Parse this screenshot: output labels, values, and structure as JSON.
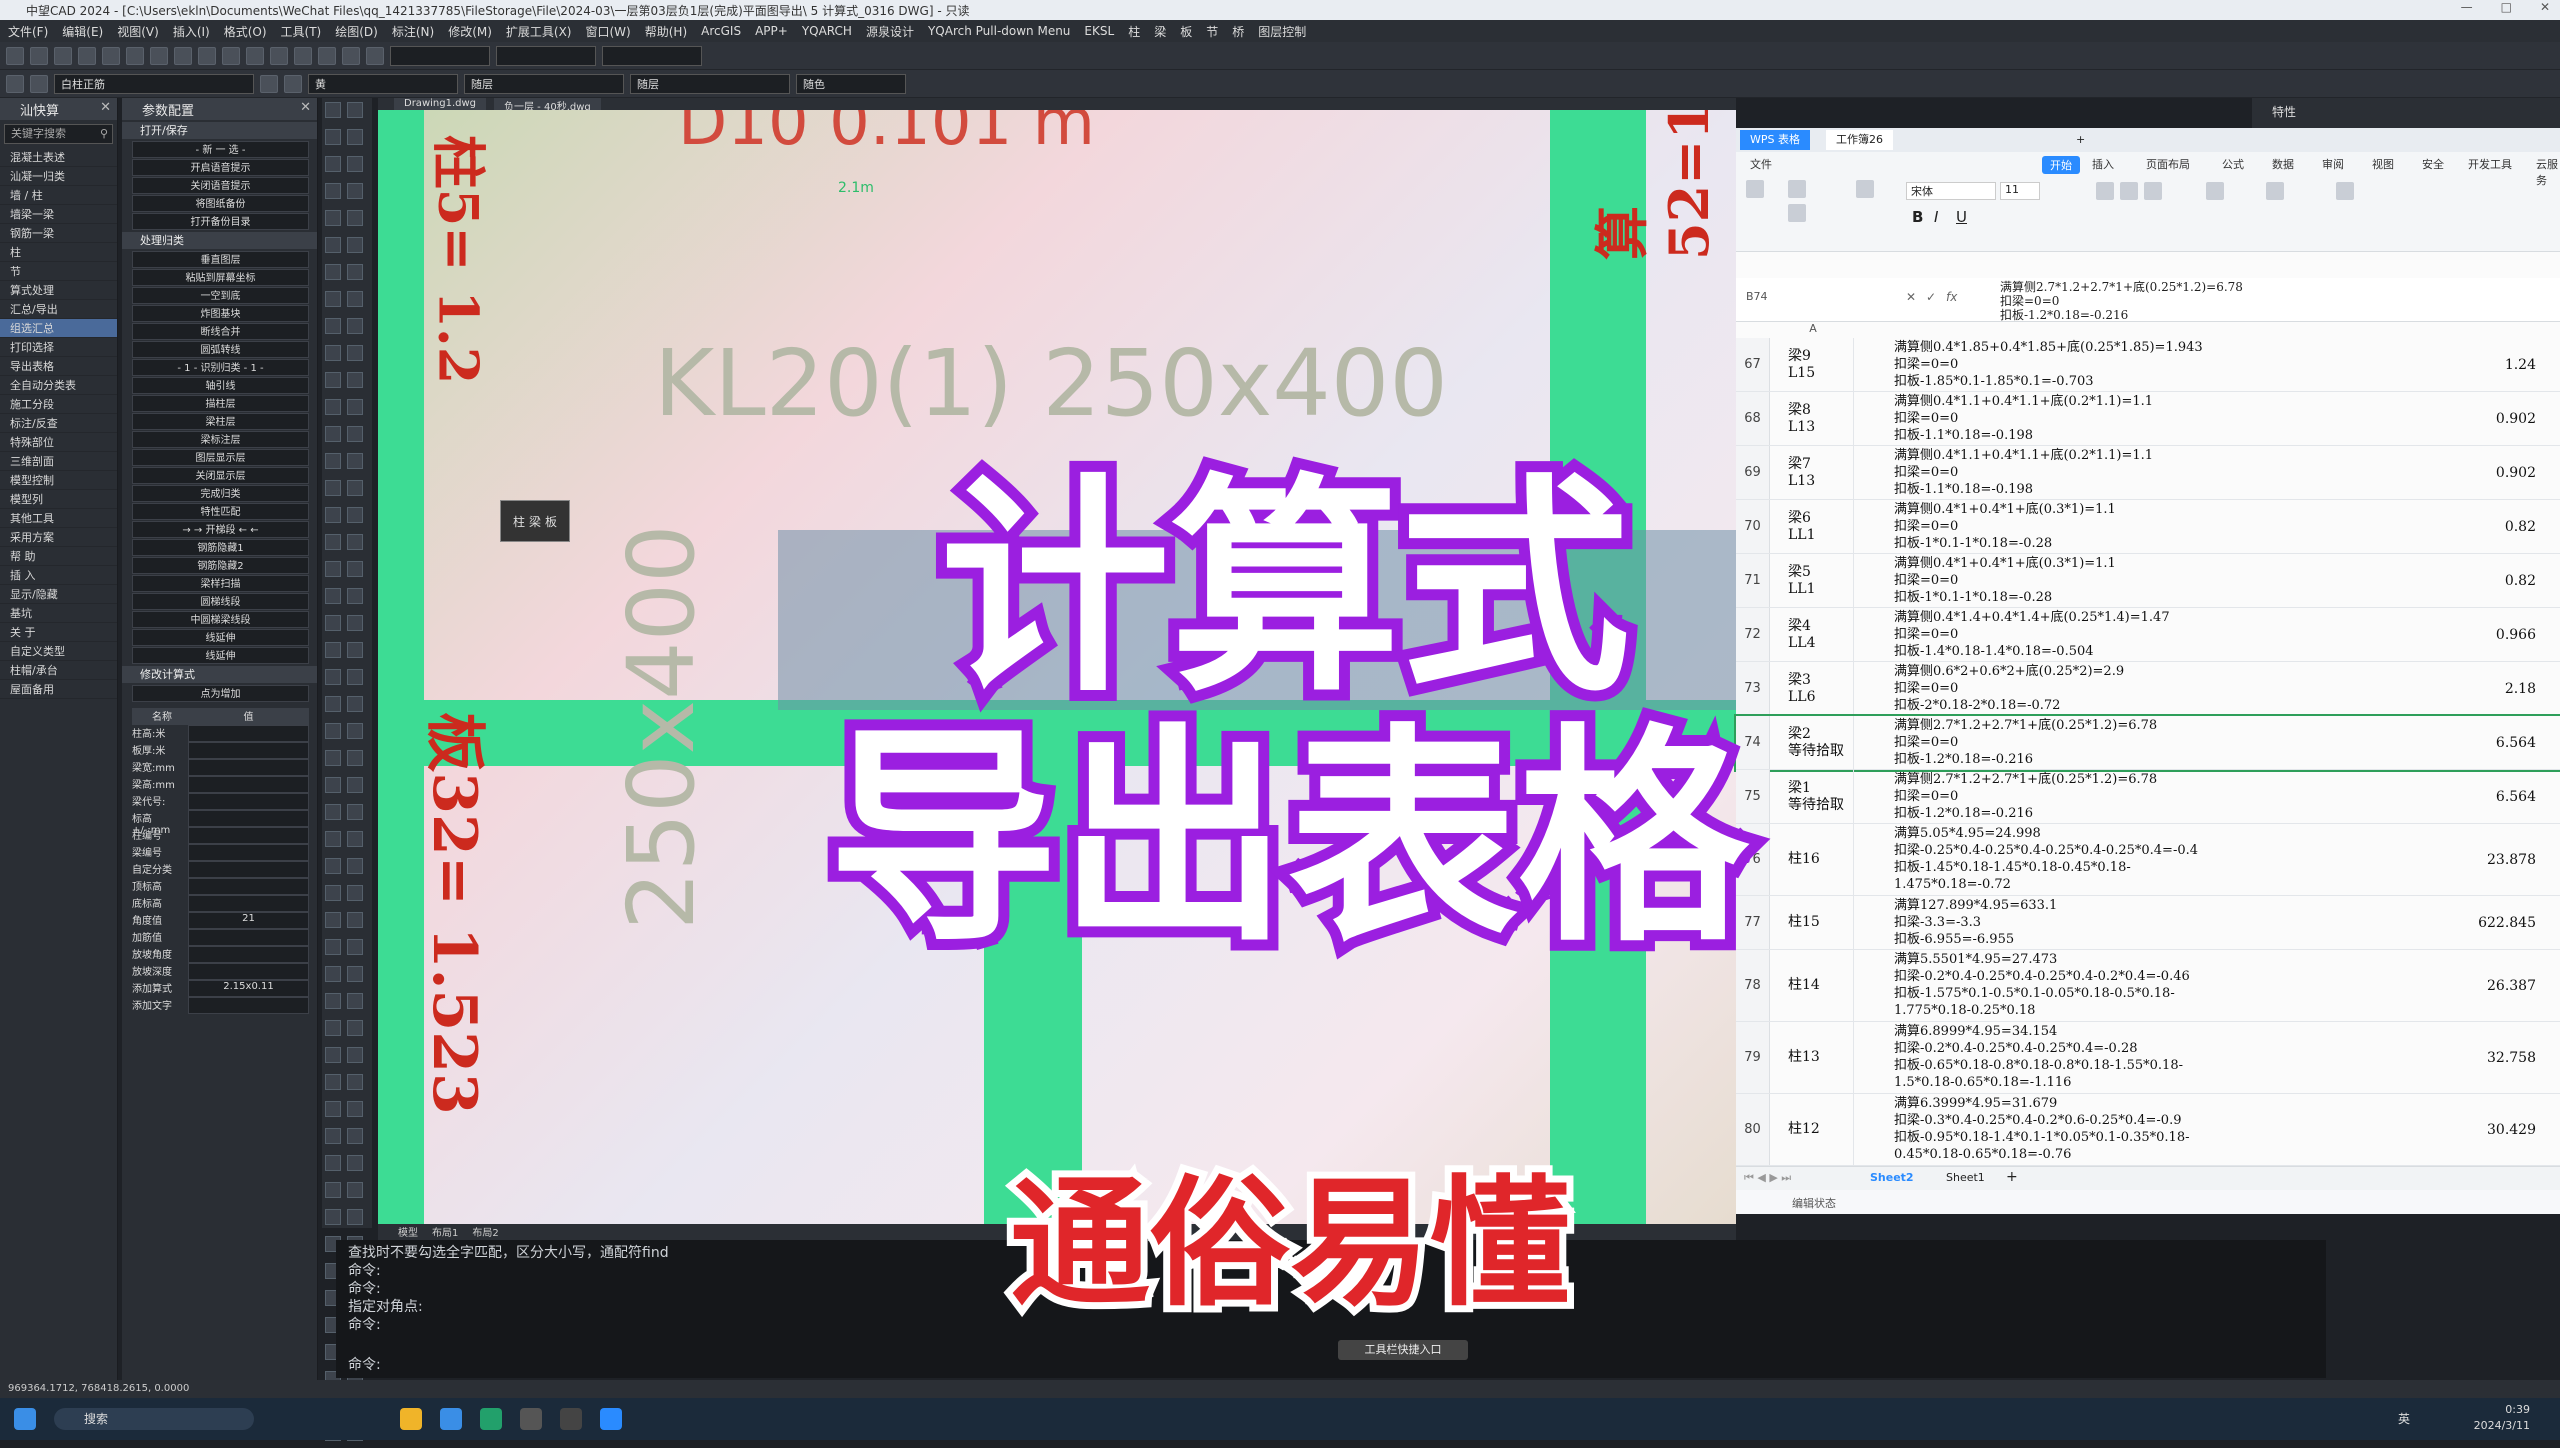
{
  "window": {
    "title": "中望CAD 2024 - [C:\\Users\\ekln\\Documents\\WeChat Files\\qq_1421337785\\FileStorage\\File\\2024-03\\一层第03层负1层(完成)平面图导出\\ 5 计算式_0316 DWG] - 只读"
  },
  "menu": [
    "文件(F)",
    "编辑(E)",
    "视图(V)",
    "插入(I)",
    "格式(O)",
    "工具(T)",
    "绘图(D)",
    "标注(N)",
    "修改(M)",
    "扩展工具(X)",
    "窗口(W)",
    "帮助(H)",
    "ArcGIS",
    "APP+",
    "YQARCH",
    "源泉设计",
    "YQArch Pull-down Menu",
    "EKSL",
    "柱",
    "梁",
    "板",
    "节",
    "桥",
    "图层控制"
  ],
  "toolbar": {
    "layer_combo": "白柱正筋",
    "color_combo": "黄",
    "linetype_combo": "随层",
    "lineweight_combo": "随层",
    "plot_combo": "随色"
  },
  "panelA": {
    "title": "汕快算",
    "search_placeholder": "关键字搜索",
    "items": [
      "混凝土表述",
      "汕凝一归类",
      "墙 / 柱",
      "墙梁一梁",
      "钢筋一梁",
      "柱",
      "节",
      "算式处理",
      "汇总/导出",
      "组选汇总",
      "打印选择",
      "导出表格",
      "全自动分类表",
      "施工分段",
      "标注/反查",
      "特殊部位",
      "三维剖面",
      "模型控制",
      "模型列",
      "其他工具",
      "采用方案",
      "帮 助",
      "插 入",
      "显示/隐藏",
      "基坑",
      "关 于",
      "自定义类型",
      "柱帽/承台",
      "屋面备用"
    ]
  },
  "panelB": {
    "title": "参数配置",
    "group1": "打开/保存",
    "group1_items": [
      "- 新 一 选 -",
      "开启语音提示",
      "关闭语音提示",
      "将图纸备份",
      "打开备份目录"
    ],
    "group2": "处理归类",
    "group2_items": [
      "垂直图层",
      "粘贴到屏幕坐标",
      "一空到底",
      "炸图基块",
      "断线合并",
      "圆弧转线",
      "- 1 - 识别归类 - 1 -",
      "轴引线",
      "描柱层",
      "梁柱层",
      "梁标注层",
      "图层显示层",
      "关闭显示层",
      "完成归类",
      "特性匹配",
      "→ → 开梯段 ← ←",
      "钢筋隐藏1",
      "钢筋隐藏2",
      "梁样扫描",
      "圆梯线段",
      "中圆梯梁线段",
      "线延伸",
      "线延伸"
    ],
    "group3": "修改计算式",
    "add_label": "点为增加",
    "prop_header": [
      "名称",
      "值"
    ],
    "props": [
      {
        "k": "柱高:米",
        "v": ""
      },
      {
        "k": "板厚:米",
        "v": ""
      },
      {
        "k": "梁宽:mm",
        "v": ""
      },
      {
        "k": "梁高:mm",
        "v": ""
      },
      {
        "k": "梁代号:",
        "v": ""
      },
      {
        "k": "标高+/-:mm",
        "v": ""
      },
      {
        "k": "柱编号",
        "v": ""
      },
      {
        "k": "梁编号",
        "v": ""
      },
      {
        "k": "自定分类",
        "v": ""
      },
      {
        "k": "顶标高",
        "v": ""
      },
      {
        "k": "底标高",
        "v": ""
      },
      {
        "k": "角度值",
        "v": "21"
      },
      {
        "k": "加筋值",
        "v": ""
      },
      {
        "k": "放坡角度",
        "v": ""
      },
      {
        "k": "放坡深度",
        "v": ""
      },
      {
        "k": "添加算式",
        "v": "2.15x0.11"
      },
      {
        "k": "添加文字",
        "v": ""
      }
    ]
  },
  "drawing": {
    "tabs": [
      "Drawing1.dwg",
      "负一层 - 40秒.dwg"
    ],
    "beam_label": "KL20(1) 250x400",
    "top_label": "D10 0.101 m",
    "side_label": "250x400",
    "red_left": "板32= 1.523",
    "red_top": "柱5= 1.2",
    "red_topright": "算52=1.6",
    "mini_label": "2.1m",
    "popup": [
      "柱",
      "梁",
      "板"
    ]
  },
  "spreadsheet": {
    "app_tab": "WPS 表格",
    "file_tab": "工作簿26",
    "ribbon_tabs": [
      "文件",
      "开始",
      "插入",
      "页面布局",
      "公式",
      "数据",
      "审阅",
      "视图",
      "安全",
      "开发工具",
      "云服务"
    ],
    "active_tab": "开始",
    "font_name": "宋体",
    "font_size": "11",
    "cell_ref": "B74",
    "formula_lines": [
      "满算侧2.7*1.2+2.7*1+底(0.25*1.2)=6.78",
      "扣梁=0=0",
      "扣板-1.2*0.18=-0.216"
    ],
    "col_header": "A",
    "rows": [
      {
        "n": "67",
        "a": "梁9\nL15",
        "b": "满算侧0.4*1.85+0.4*1.85+底(0.25*1.85)=1.943\n扣梁=0=0\n扣板-1.85*0.1-1.85*0.1=-0.703",
        "c": "1.24"
      },
      {
        "n": "68",
        "a": "梁8\nL13",
        "b": "满算侧0.4*1.1+0.4*1.1+底(0.2*1.1)=1.1\n扣梁=0=0\n扣板-1.1*0.18=-0.198",
        "c": "0.902"
      },
      {
        "n": "69",
        "a": "梁7\nL13",
        "b": "满算侧0.4*1.1+0.4*1.1+底(0.2*1.1)=1.1\n扣梁=0=0\n扣板-1.1*0.18=-0.198",
        "c": "0.902"
      },
      {
        "n": "70",
        "a": "梁6\nLL1",
        "b": "满算侧0.4*1+0.4*1+底(0.3*1)=1.1\n扣梁=0=0\n扣板-1*0.1-1*0.18=-0.28",
        "c": "0.82"
      },
      {
        "n": "71",
        "a": "梁5\nLL1",
        "b": "满算侧0.4*1+0.4*1+底(0.3*1)=1.1\n扣梁=0=0\n扣板-1*0.1-1*0.18=-0.28",
        "c": "0.82"
      },
      {
        "n": "72",
        "a": "梁4\nLL4",
        "b": "满算侧0.4*1.4+0.4*1.4+底(0.25*1.4)=1.47\n扣梁=0=0\n扣板-1.4*0.18-1.4*0.18=-0.504",
        "c": "0.966"
      },
      {
        "n": "73",
        "a": "梁3\nLL6",
        "b": "满算侧0.6*2+0.6*2+底(0.25*2)=2.9\n扣梁=0=0\n扣板-2*0.18-2*0.18=-0.72",
        "c": "2.18"
      },
      {
        "n": "74",
        "a": "梁2\n等待拾取",
        "b": "满算侧2.7*1.2+2.7*1+底(0.25*1.2)=6.78\n扣梁=0=0\n扣板-1.2*0.18=-0.216",
        "c": "6.564"
      },
      {
        "n": "75",
        "a": "梁1\n等待拾取",
        "b": "满算侧2.7*1.2+2.7*1+底(0.25*1.2)=6.78\n扣梁=0=0\n扣板-1.2*0.18=-0.216",
        "c": "6.564"
      },
      {
        "n": "76",
        "a": "柱16",
        "b": "满算5.05*4.95=24.998\n扣梁-0.25*0.4-0.25*0.4-0.25*0.4-0.25*0.4=-0.4\n扣板-1.45*0.18-1.45*0.18-0.45*0.18-\n1.475*0.18=-0.72",
        "c": "23.878"
      },
      {
        "n": "77",
        "a": "柱15",
        "b": "满算127.899*4.95=633.1\n扣梁-3.3=-3.3\n扣板-6.955=-6.955",
        "c": "622.845"
      },
      {
        "n": "78",
        "a": "柱14",
        "b": "满算5.5501*4.95=27.473\n扣梁-0.2*0.4-0.25*0.4-0.25*0.4-0.2*0.4=-0.46\n扣板-1.575*0.1-0.5*0.1-0.05*0.18-0.5*0.18-\n1.775*0.18-0.25*0.18",
        "c": "26.387"
      },
      {
        "n": "79",
        "a": "柱13",
        "b": "满算6.8999*4.95=34.154\n扣梁-0.2*0.4-0.25*0.4-0.25*0.4=-0.28\n扣板-0.65*0.18-0.8*0.18-0.8*0.18-1.55*0.18-\n1.5*0.18-0.65*0.18=-1.116",
        "c": "32.758"
      },
      {
        "n": "80",
        "a": "柱12",
        "b": "满算6.3999*4.95=31.679\n扣梁-0.3*0.4-0.25*0.4-0.2*0.6-0.25*0.4=-0.9\n扣板-0.95*0.18-1.4*0.1-1*0.05*0.1-0.35*0.18-\n0.45*0.18-0.65*0.18=-0.76",
        "c": "30.429"
      }
    ],
    "sheet_tabs": [
      "Sheet2",
      "Sheet1"
    ],
    "status": "编辑状态"
  },
  "props_right": {
    "title": "特性"
  },
  "command": {
    "tabs": [
      "模型",
      "布局1",
      "布局2"
    ],
    "lines": [
      "查找时不要勾选全字匹配，区分大小写，通配符find",
      "命令:",
      "命令:",
      "指定对角点:",
      "命令:"
    ],
    "prompt": "命令:"
  },
  "status_coords": "969364.1712, 768418.2615, 0.0000",
  "popup_mid": "工具栏快捷入口",
  "taskbar": {
    "search": "搜索",
    "time": "0:39",
    "date": "2024/3/11",
    "lang": "英"
  },
  "captions": {
    "main1": "计算式",
    "main2": "导出表格",
    "sub": "通俗易懂"
  },
  "colors": {
    "beam_green": "#3ddc94",
    "caption_stroke": "#9b1fe0",
    "sub_fill": "#e0262a",
    "accent_blue": "#2a8bff"
  }
}
